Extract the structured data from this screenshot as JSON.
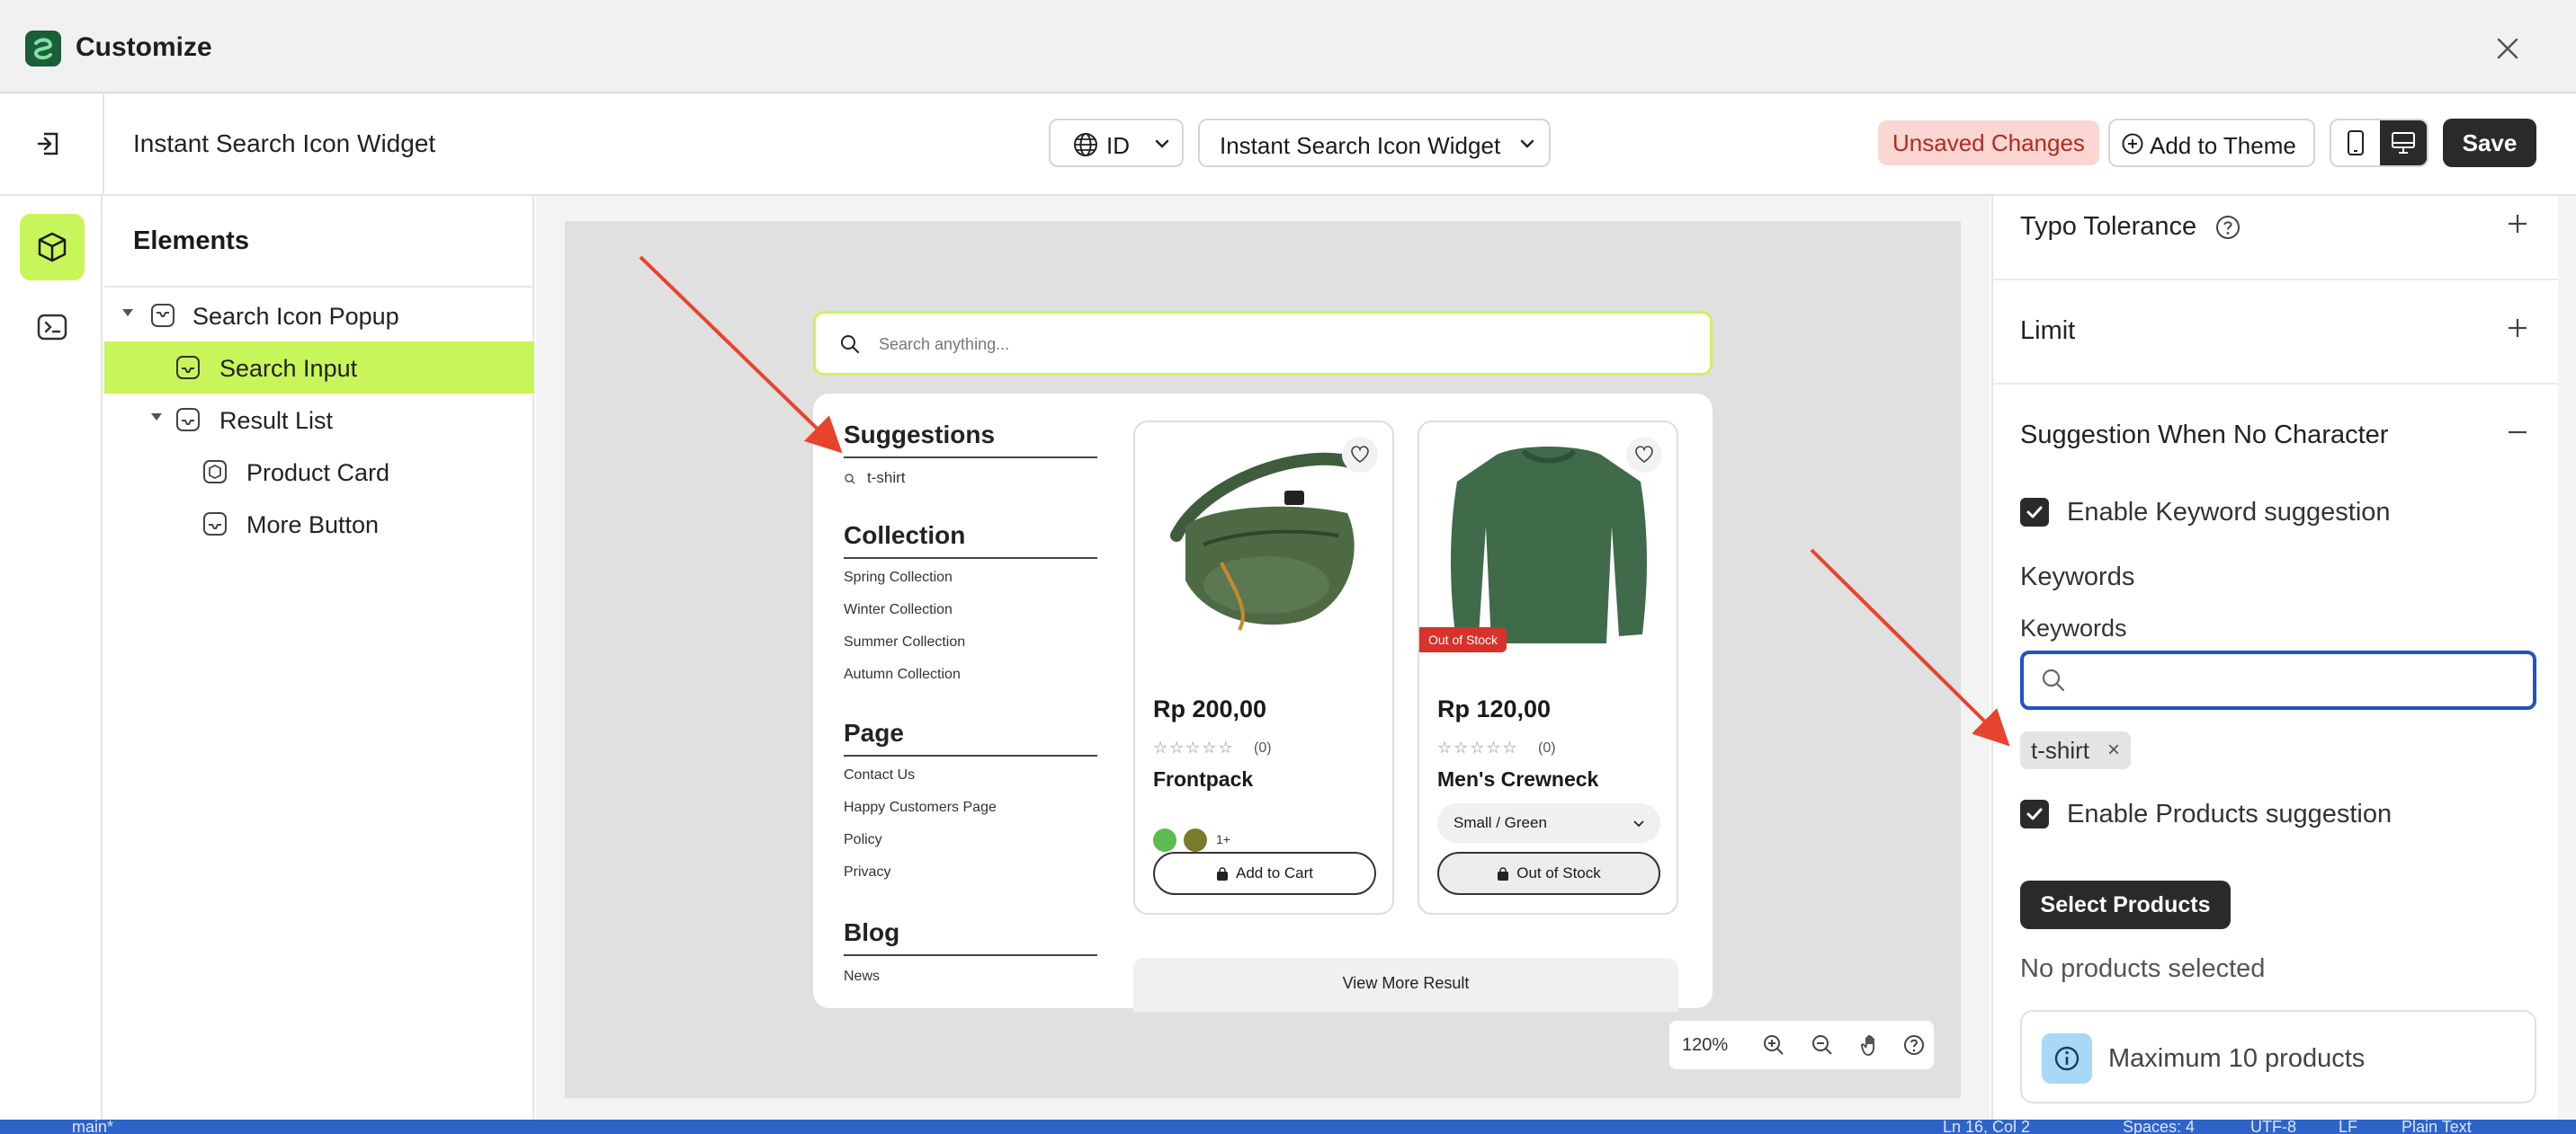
{
  "titlebar": {
    "title": "Customize"
  },
  "toolbar": {
    "page_name": "Instant Search Icon Widget",
    "language": "ID",
    "widget_select": "Instant Search Icon Widget",
    "unsaved": "Unsaved Changes",
    "add_to_theme": "Add to Theme",
    "save": "Save"
  },
  "elements": {
    "title": "Elements",
    "tree": [
      {
        "label": "Search Icon Popup"
      },
      {
        "label": "Search Input"
      },
      {
        "label": "Result List"
      },
      {
        "label": "Product Card"
      },
      {
        "label": "More Button"
      }
    ]
  },
  "preview": {
    "search_placeholder": "Search anything...",
    "suggestions_title": "Suggestions",
    "suggestion_item": "t-shirt",
    "collection_title": "Collection",
    "collections": [
      "Spring Collection",
      "Winter Collection",
      "Summer Collection",
      "Autumn Collection"
    ],
    "page_title": "Page",
    "pages": [
      "Contact Us",
      "Happy Customers Page",
      "Policy",
      "Privacy"
    ],
    "blog_title": "Blog",
    "blogs": [
      "News"
    ],
    "products": [
      {
        "price": "Rp 200,00",
        "rating": "(0)",
        "name": "Frontpack",
        "more_colors": "1+",
        "button": "Add to Cart"
      },
      {
        "price": "Rp 120,00",
        "rating": "(0)",
        "name": "Men's Crewneck",
        "badge": "Out of Stock",
        "variant": "Small / Green",
        "button": "Out of Stock"
      }
    ],
    "view_more": "View More Result",
    "zoom": "120%"
  },
  "settings": {
    "typo_tolerance": "Typo Tolerance",
    "limit": "Limit",
    "suggestion_section": "Suggestion When No Character",
    "enable_keyword": "Enable Keyword suggestion",
    "keywords_heading": "Keywords",
    "keywords_label": "Keywords",
    "keywords_value": "",
    "keyword_tag": "t-shirt",
    "enable_products": "Enable Products suggestion",
    "select_products": "Select Products",
    "no_products": "No products selected",
    "max_products": "Maximum 10 products"
  },
  "status": {
    "branch": "main*",
    "position": "Ln 16, Col 2",
    "spaces": "Spaces: 4",
    "encoding": "UTF-8",
    "eol": "LF",
    "language": "Plain Text"
  },
  "colors": {
    "accent": "#c8f55a",
    "dark": "#2a2a2a",
    "focus": "#2251c4",
    "danger": "#d8322b",
    "badge_bg": "#fbd6d2",
    "arrow": "#e8432d"
  }
}
